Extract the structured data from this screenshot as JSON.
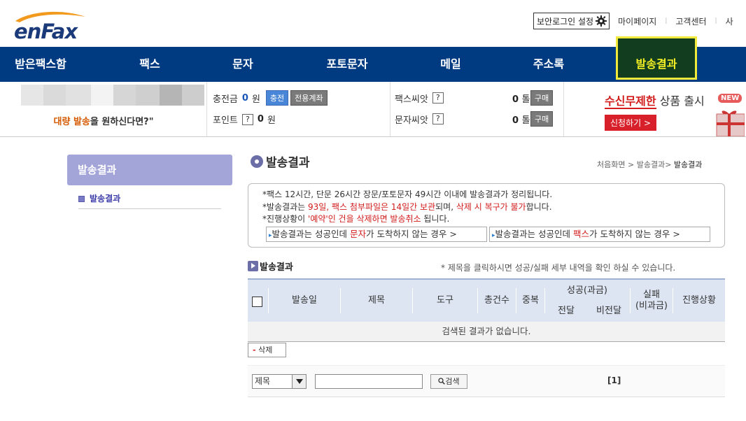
{
  "brand": {
    "logo_text": "enFax"
  },
  "top_links": {
    "security_login": "보안로그인 설정",
    "mypage": "마이페이지",
    "support": "고객센터",
    "more": "사"
  },
  "nav": {
    "items": [
      {
        "label": "받은팩스함"
      },
      {
        "label": "팩스"
      },
      {
        "label": "문자"
      },
      {
        "label": "포토문자"
      },
      {
        "label": "메일"
      },
      {
        "label": "주소록"
      },
      {
        "label": "발송결과",
        "active": true
      }
    ]
  },
  "infobar": {
    "bulk_prefix": "대량 발송",
    "bulk_suffix": "을 원하신다면?\"",
    "charge_label": "충전금",
    "charge_value": "0",
    "charge_unit": "원",
    "charge_btn": "충전",
    "account_btn": "전용계좌",
    "point_label": "포인트",
    "point_q": "?",
    "point_value": "0",
    "point_unit": "원",
    "fax_seed_label": "팩스씨앗",
    "fax_seed_q": "?",
    "fax_seed_value": "0",
    "fax_seed_unit": "톨",
    "fax_seed_btn": "구매",
    "sms_seed_label": "문자씨앗",
    "sms_seed_q": "?",
    "sms_seed_value": "0",
    "sms_seed_unit": "톨",
    "sms_seed_btn": "구매",
    "promo_red": "수신무제한",
    "promo_rest": " 상품 출시",
    "promo_btn": "신청하기 >",
    "new_badge": "NEW"
  },
  "sidebar": {
    "header": "발송결과",
    "items": [
      {
        "label": "발송결과"
      }
    ]
  },
  "main": {
    "title": "발송결과",
    "breadcrumb": {
      "home": "처음화면",
      "sep1": " > ",
      "mid": "발송결과",
      "sep2": "> ",
      "current": "발송결과"
    },
    "notice": {
      "line1": "*팩스 12시간, 단문 26시간 장문/포토문자 49시간 이내에 발송결과가 정리됩니다.",
      "line2_a": "*발송결과는 ",
      "line2_b": "93일, 팩스 첨부파일은 14일간 보관",
      "line2_c": "되며, ",
      "line2_d": "삭제 시 복구가 불가",
      "line2_e": "합니다.",
      "line3_a": "*진행상황이 ",
      "line3_b": "'예약'인 건을 삭제하면 발송취소",
      "line3_c": " 됩니다.",
      "link1_a": "발송결과는 성공인데 ",
      "link1_b": "문자",
      "link1_c": "가 도착하지 않는 경우 >",
      "link2_a": "발송결과는 성공인데 ",
      "link2_b": "팩스",
      "link2_c": "가 도착하지 않는 경우 >"
    },
    "section_title": "발송결과",
    "section_hint": "* 제목을 클릭하시면 성공/실패 세부 내역을 확인 하실 수 있습니다.",
    "table": {
      "columns": [
        "발송일",
        "제목",
        "도구",
        "총건수",
        "중복"
      ],
      "success_group": "성공(과금)",
      "success_sub": [
        "전달",
        "비전달"
      ],
      "fail": "실패",
      "fail_sub": "(비과금)",
      "status": "진행상황",
      "empty_text": "검색된 결과가 없습니다."
    },
    "delete_btn": "삭제",
    "search": {
      "select_value": "제목",
      "input_value": "",
      "button": "검색"
    },
    "pager": "[1]"
  }
}
